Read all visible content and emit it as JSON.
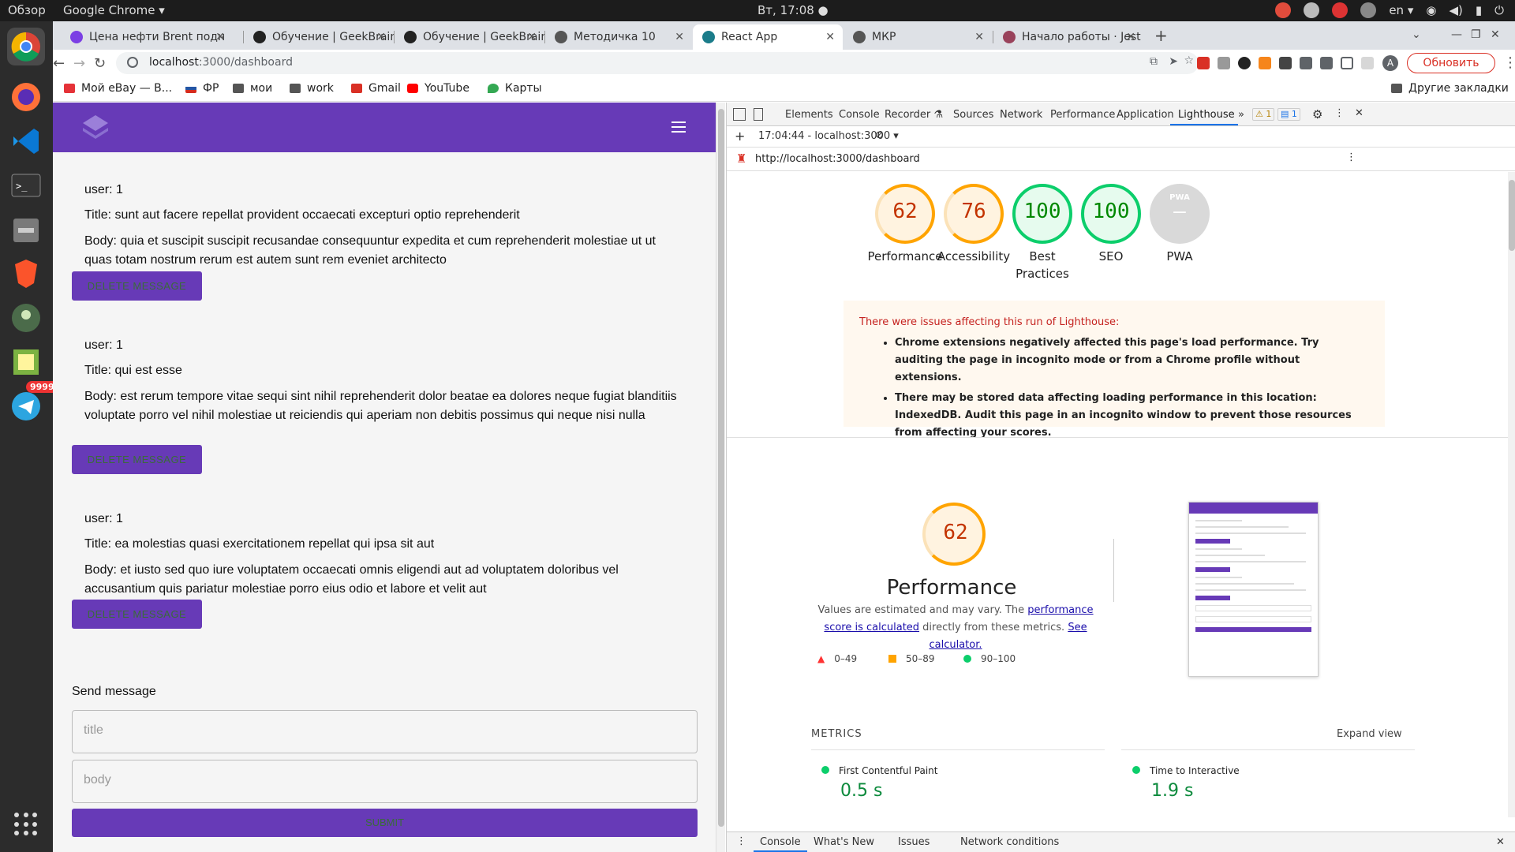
{
  "topbar": {
    "overview": "Обзор",
    "app": "Google Chrome ▾",
    "clock": "Вт, 17:08 ●",
    "lang": "en ▾"
  },
  "dock": {
    "badge": "9999"
  },
  "tabs": [
    {
      "title": "Цена нефти Brent подн",
      "color": "#7b3fe4"
    },
    {
      "title": "Обучение | GeekBrains -",
      "color": "#222"
    },
    {
      "title": "Обучение | GeekBrains -",
      "color": "#222"
    },
    {
      "title": "Методичка 10",
      "color": "#555"
    },
    {
      "title": "React App",
      "color": "#1b7c8a",
      "active": true
    },
    {
      "title": "МКР",
      "color": "#555"
    },
    {
      "title": "Начало работы · Jest",
      "color": "#99425b"
    }
  ],
  "toolbar": {
    "host": "localhost",
    "path": ":3000/dashboard",
    "update": "Обновить",
    "avatar": "A"
  },
  "bookmarks": [
    {
      "label": "Мой eBay — В...",
      "color": "#e53238"
    },
    {
      "label": "ФР",
      "color": "#2455a4"
    },
    {
      "label": "мои",
      "color": "#555"
    },
    {
      "label": "work",
      "color": "#555"
    },
    {
      "label": "Gmail",
      "color": "#d93025"
    },
    {
      "label": "YouTube",
      "color": "#ff0000"
    },
    {
      "label": "Карты",
      "color": "#34a853"
    }
  ],
  "bookmarks_other": "Другие закладки",
  "messages": [
    {
      "user": "user: 1",
      "title": "Title: sunt aut facere repellat provident occaecati excepturi optio reprehenderit",
      "body": "Body: quia et suscipit suscipit recusandae consequuntur expedita et cum reprehenderit molestiae ut ut quas totam nostrum rerum est autem sunt rem eveniet architecto"
    },
    {
      "user": "user: 1",
      "title": "Title: qui est esse",
      "body": "Body: est rerum tempore vitae sequi sint nihil reprehenderit dolor beatae ea dolores neque fugiat blanditiis voluptate porro vel nihil molestiae ut reiciendis qui aperiam non debitis possimus qui neque nisi nulla"
    },
    {
      "user": "user: 1",
      "title": "Title: ea molestias quasi exercitationem repellat qui ipsa sit aut",
      "body": "Body: et iusto sed quo iure voluptatem occaecati omnis eligendi aut ad voluptatem doloribus vel accusantium quis pariatur molestiae porro eius odio et labore et velit aut"
    }
  ],
  "delete_label": "DELETE MESSAGE",
  "form": {
    "heading": "Send message",
    "title_placeholder": "title",
    "body_placeholder": "body",
    "submit": "SUBMIT"
  },
  "devtools": {
    "tabs": [
      "Elements",
      "Console",
      "Recorder ⚗",
      "Sources",
      "Network",
      "Performance",
      "Application",
      "Lighthouse"
    ],
    "more": "»",
    "warn_count": "1",
    "info_count": "1",
    "report_select": "17:04:44 - localhost:3000 ▾",
    "url": "http://localhost:3000/dashboard",
    "drawer_tabs": [
      "Console",
      "What's New",
      "Issues",
      "Network conditions"
    ]
  },
  "lighthouse": {
    "scores": [
      {
        "label": "Performance",
        "value": "62",
        "color": "#ffa400"
      },
      {
        "label": "Accessibility",
        "value": "76",
        "color": "#ffa400"
      },
      {
        "label": "Best\nPractices",
        "value": "100",
        "color": "#0cce6b"
      },
      {
        "label": "SEO",
        "value": "100",
        "color": "#0cce6b"
      },
      {
        "label": "PWA",
        "value": "—",
        "color": "#ccc"
      }
    ],
    "pwa_small": "PWA",
    "warning_title": "There were issues affecting this run of Lighthouse:",
    "warnings": [
      "Chrome extensions negatively affected this page's load performance. Try auditing the page in incognito mode or from a Chrome profile without extensions.",
      "There may be stored data affecting loading performance in this location: IndexedDB. Audit this page in an incognito window to prevent those resources from affecting your scores."
    ],
    "perf_score": "62",
    "perf_title": "Performance",
    "perf_desc_1": "Values are estimated and may vary. The ",
    "perf_link_1": "performance score is calculated",
    "perf_desc_2": " directly from these metrics. ",
    "perf_link_2": "See calculator.",
    "legend": [
      {
        "label": "0–49",
        "color": "#ff3333"
      },
      {
        "label": "50–89",
        "color": "#ffa400"
      },
      {
        "label": "90–100",
        "color": "#0cce6b"
      }
    ],
    "metrics_header": "METRICS",
    "expand": "Expand view",
    "metrics": [
      {
        "name": "First Contentful Paint",
        "value": "0.5 s"
      },
      {
        "name": "Time to Interactive",
        "value": "1.9 s"
      }
    ]
  }
}
